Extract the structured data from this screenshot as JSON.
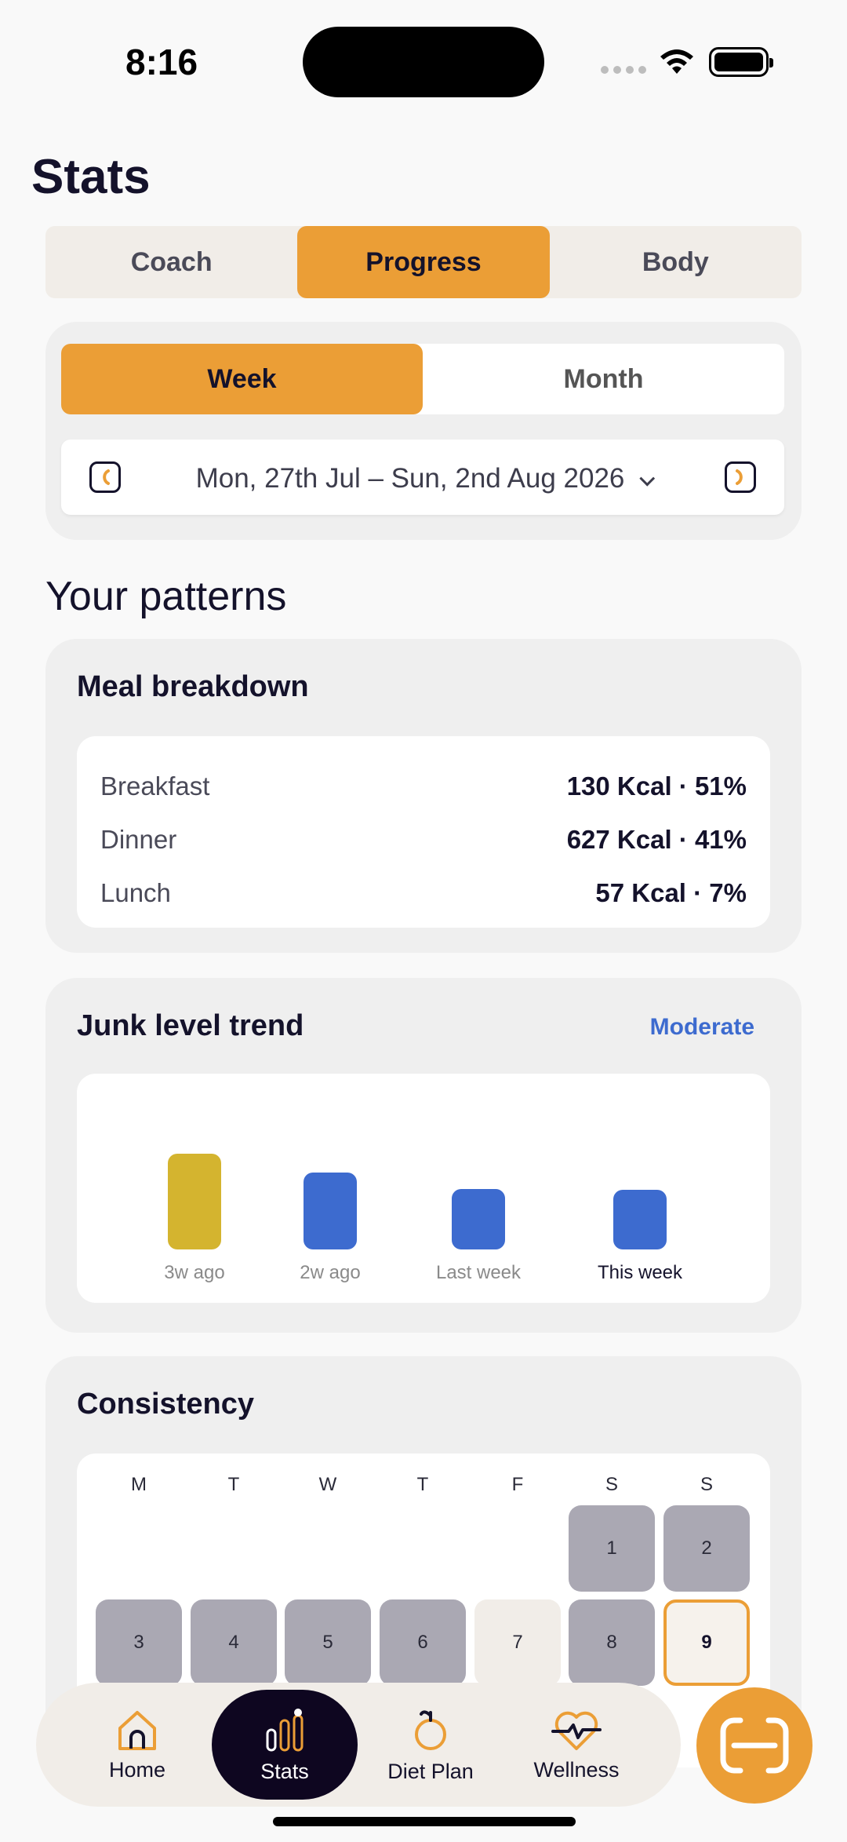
{
  "status_bar": {
    "time": "8:16"
  },
  "page": {
    "title": "Stats"
  },
  "top_tabs": [
    {
      "label": "Coach",
      "active": false
    },
    {
      "label": "Progress",
      "active": true
    },
    {
      "label": "Body",
      "active": false
    }
  ],
  "range": {
    "options": [
      {
        "label": "Week",
        "active": true
      },
      {
        "label": "Month",
        "active": false
      }
    ],
    "date_label": "Mon, 27th Jul – Sun, 2nd Aug 2026"
  },
  "patterns": {
    "title": "Your patterns"
  },
  "meal_breakdown": {
    "title": "Meal breakdown",
    "rows": [
      {
        "name": "Breakfast",
        "value": "130 Kcal · 51%"
      },
      {
        "name": "Dinner",
        "value": "627 Kcal · 41%"
      },
      {
        "name": "Lunch",
        "value": "57 Kcal · 7%"
      }
    ]
  },
  "junk_trend": {
    "title": "Junk level trend",
    "level": "Moderate",
    "colors": {
      "high": "#d4b42f",
      "normal": "#3d6bcf"
    },
    "bars": [
      {
        "label": "3w ago",
        "value": 1.0,
        "color": "#d4b42f"
      },
      {
        "label": "2w ago",
        "value": 0.8,
        "color": "#3d6bcf"
      },
      {
        "label": "Last week",
        "value": 0.63,
        "color": "#3d6bcf"
      },
      {
        "label": "This week",
        "value": 0.62,
        "color": "#3d6bcf"
      }
    ]
  },
  "consistency": {
    "title": "Consistency",
    "weekdays": [
      "M",
      "T",
      "W",
      "T",
      "F",
      "S",
      "S"
    ],
    "week1": [
      "1",
      "2"
    ],
    "week2": [
      "3",
      "4",
      "5",
      "6",
      "7",
      "8",
      "9"
    ]
  },
  "bottom_nav": [
    {
      "label": "Home",
      "icon": "home-icon"
    },
    {
      "label": "Stats",
      "icon": "stats-icon"
    },
    {
      "label": "Diet Plan",
      "icon": "apple-icon"
    },
    {
      "label": "Wellness",
      "icon": "heart-pulse-icon"
    }
  ],
  "accent_color": "#eb9e36"
}
